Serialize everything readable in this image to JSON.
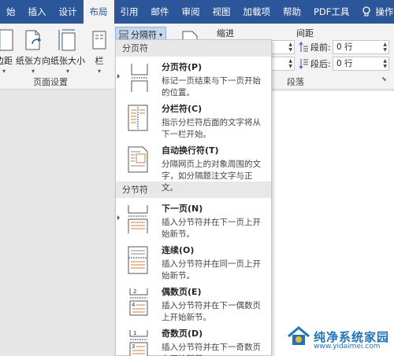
{
  "tabs": [
    {
      "label": "始",
      "active": false
    },
    {
      "label": "插入",
      "active": false
    },
    {
      "label": "设计",
      "active": false
    },
    {
      "label": "布局",
      "active": true
    },
    {
      "label": "引用",
      "active": false
    },
    {
      "label": "邮件",
      "active": false
    },
    {
      "label": "审阅",
      "active": false
    },
    {
      "label": "视图",
      "active": false
    },
    {
      "label": "加载项",
      "active": false
    },
    {
      "label": "帮助",
      "active": false
    },
    {
      "label": "PDF工具",
      "active": false
    }
  ],
  "tell_me": "操作说",
  "ribbon": {
    "margins": "边距",
    "orientation": "纸张方向",
    "size": "纸张大小",
    "columns": "栏",
    "breaks_button": "分隔符",
    "group_page_setup": "页面设置",
    "indent": "缩进",
    "spacing": "间距",
    "before_label": "段前:",
    "before_value": "0 行",
    "after_label": "段后:",
    "after_value": "0 行",
    "group_paragraph": "段落"
  },
  "menu": {
    "section_page": "分页符",
    "section_section": "分节符",
    "items": [
      {
        "title": "分页符(P)",
        "desc": "标记一页结束与下一页开始的位置。",
        "icon": "page-break-icon"
      },
      {
        "title": "分栏符(C)",
        "desc": "指示分栏符后面的文字将从下一栏开始。",
        "icon": "column-break-icon"
      },
      {
        "title": "自动换行符(T)",
        "desc": "分隔网页上的对象周围的文字，如分隔题注文字与正文。",
        "icon": "text-wrapping-icon"
      },
      {
        "title": "下一页(N)",
        "desc": "插入分节符并在下一页上开始新节。",
        "icon": "next-page-icon"
      },
      {
        "title": "连续(O)",
        "desc": "插入分节符并在同一页上开始新节。",
        "icon": "continuous-icon"
      },
      {
        "title": "偶数页(E)",
        "desc": "插入分节符并在下一偶数页上开始新节。",
        "icon": "even-page-icon"
      },
      {
        "title": "奇数页(D)",
        "desc": "插入分节符并在下一奇数页上开始新节。",
        "icon": "odd-page-icon"
      }
    ]
  },
  "watermark": {
    "text": "纯净系统家园",
    "url": "www.yidaimei.com"
  }
}
